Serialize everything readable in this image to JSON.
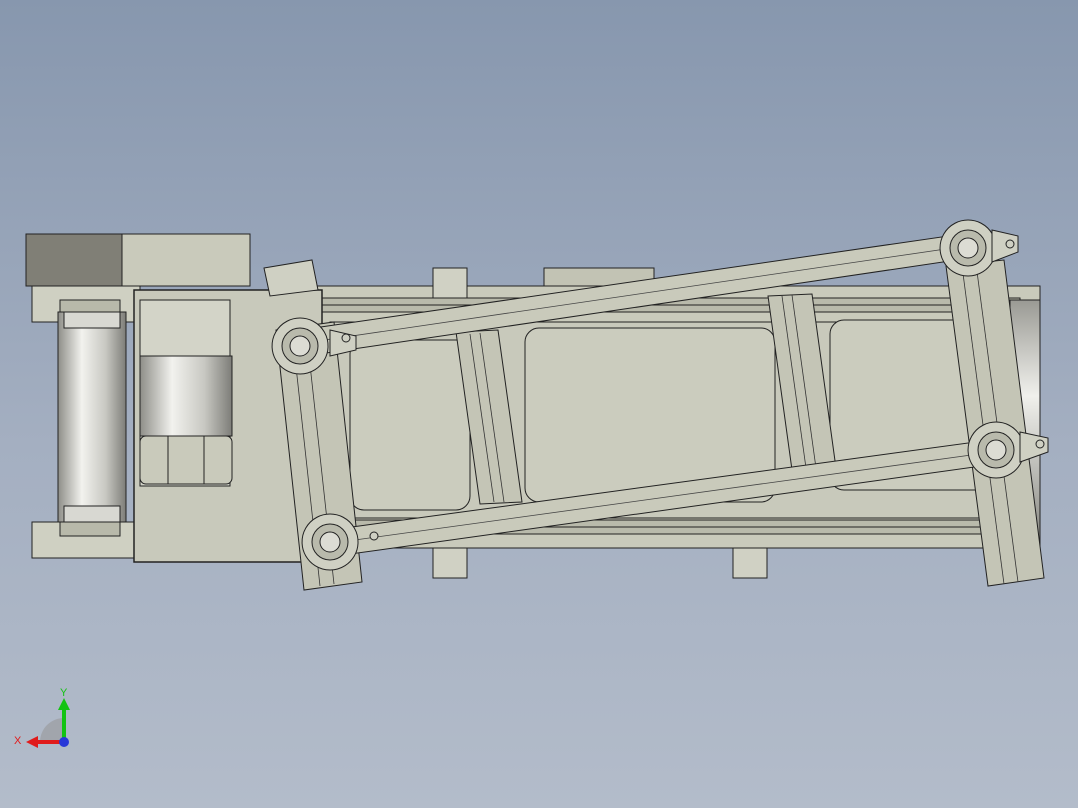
{
  "viewport": {
    "background_top": "#8797ae",
    "background_bottom": "#b3bcca"
  },
  "model": {
    "description_icon": "cad-assembly-conveyor-top-view",
    "body_color": "#c5c6b6",
    "edge_color": "#1f1f1f",
    "dark_block_color": "#807f76",
    "roller_color": "#d9d9d4"
  },
  "triad": {
    "x_label": "X",
    "y_label": "Y",
    "x_color": "#e01b1b",
    "y_color": "#13c313",
    "z_color": "#2838d8"
  }
}
